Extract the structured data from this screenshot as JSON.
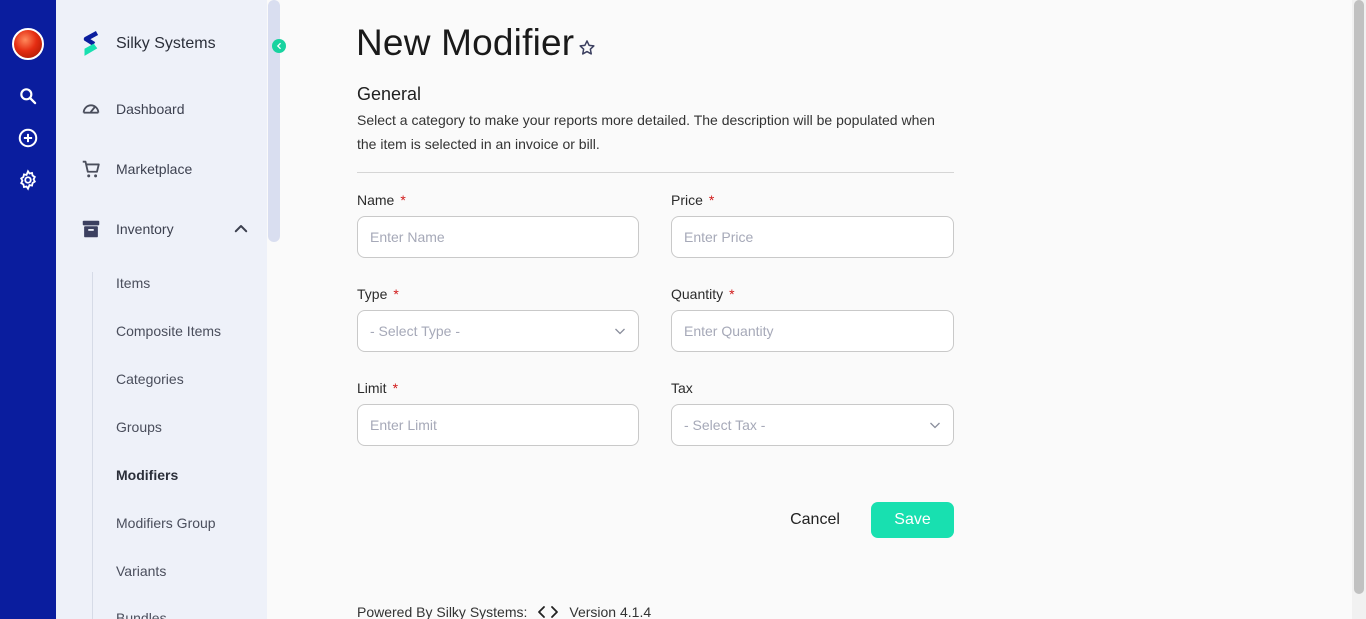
{
  "brand": {
    "name": "Silky Systems"
  },
  "rail": {
    "items": [
      {
        "icon": "avatar"
      },
      {
        "icon": "search-icon"
      },
      {
        "icon": "add-circle-icon"
      },
      {
        "icon": "settings-icon"
      }
    ]
  },
  "sidebar": {
    "nav": [
      {
        "label": "Dashboard",
        "icon": "speedometer-icon"
      },
      {
        "label": "Marketplace",
        "icon": "cart-icon"
      },
      {
        "label": "Inventory",
        "icon": "archive-icon",
        "expanded": true
      }
    ],
    "inventory_items": [
      {
        "label": "Items"
      },
      {
        "label": "Composite Items"
      },
      {
        "label": "Categories"
      },
      {
        "label": "Groups"
      },
      {
        "label": "Modifiers",
        "active": true
      },
      {
        "label": "Modifiers Group"
      },
      {
        "label": "Variants"
      },
      {
        "label": "Bundles"
      }
    ]
  },
  "page": {
    "title": "New Modifier",
    "section_title": "General",
    "section_description": "Select a category to make your reports more detailed. The description will be populated when the item is selected in an invoice or bill."
  },
  "form": {
    "name": {
      "label": "Name",
      "required_mark": "*",
      "placeholder": "Enter Name",
      "value": ""
    },
    "price": {
      "label": "Price",
      "required_mark": "*",
      "placeholder": "Enter Price",
      "value": ""
    },
    "type": {
      "label": "Type",
      "required_mark": "*",
      "selected": "- Select Type -"
    },
    "quantity": {
      "label": "Quantity",
      "required_mark": "*",
      "placeholder": "Enter Quantity",
      "value": ""
    },
    "limit": {
      "label": "Limit",
      "required_mark": "*",
      "placeholder": "Enter Limit",
      "value": ""
    },
    "tax": {
      "label": "Tax",
      "selected": "- Select Tax -"
    }
  },
  "actions": {
    "cancel_label": "Cancel",
    "save_label": "Save"
  },
  "footer": {
    "powered_by": "Powered By Silky Systems:",
    "version": "Version 4.1.4"
  },
  "colors": {
    "rail_bg": "#0a1d9e",
    "sidebar_bg": "#eef1f9",
    "accent": "#18e0b0",
    "required": "#d11a1a"
  }
}
